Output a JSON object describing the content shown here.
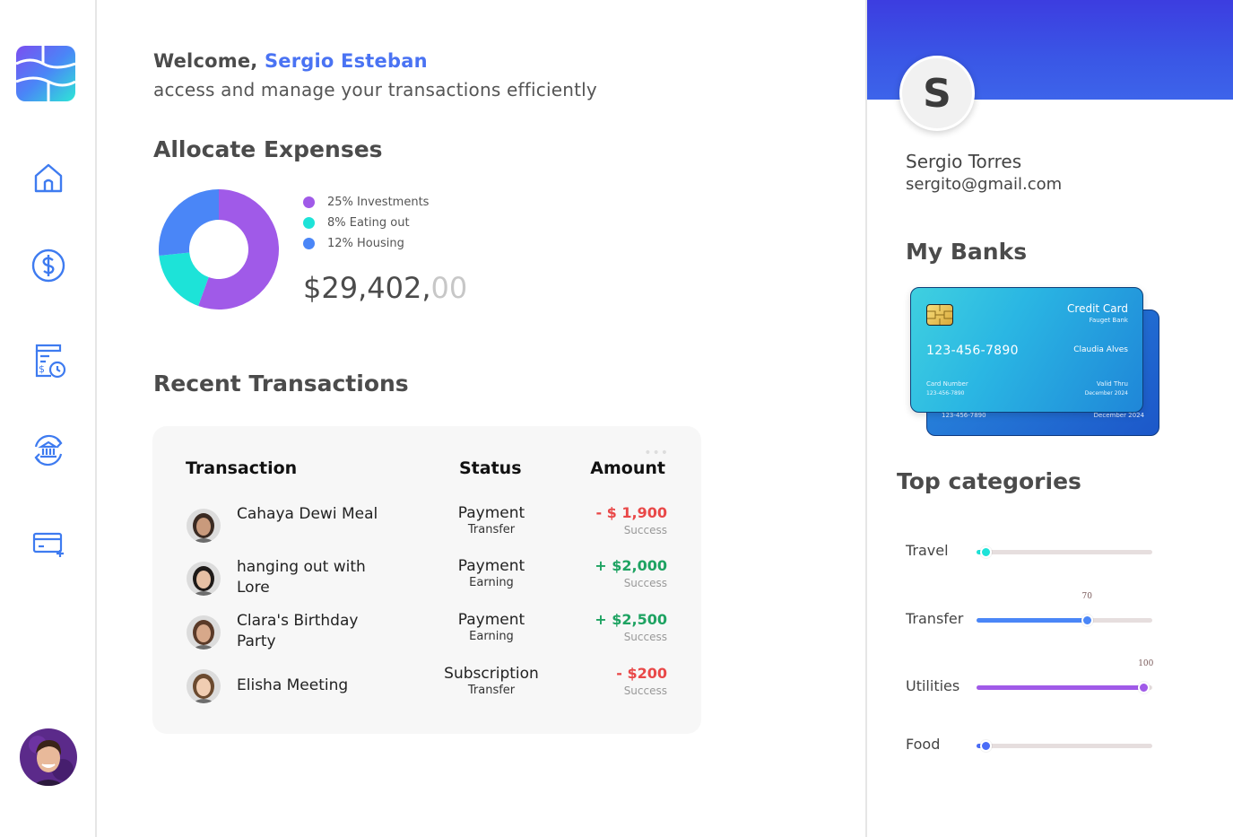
{
  "colors": {
    "accent": "#4a73f3",
    "investments": "#a05ae8",
    "eating_out": "#1de3d8",
    "housing": "#4a86f7",
    "negative": "#e94848",
    "positive": "#1ea362"
  },
  "sidebar": {
    "nav": [
      {
        "icon": "home-icon"
      },
      {
        "icon": "dollar-icon"
      },
      {
        "icon": "receipt-clock-icon"
      },
      {
        "icon": "bank-transfer-icon"
      },
      {
        "icon": "card-add-icon"
      }
    ]
  },
  "header": {
    "welcome_label": "Welcome, ",
    "user_name": "Sergio Esteban",
    "subtitle": "access and manage your transactions efficiently"
  },
  "expenses": {
    "title": "Allocate Expenses",
    "legend": [
      {
        "label": "25% Investments",
        "color": "#a05ae8"
      },
      {
        "label": "8% Eating out",
        "color": "#1de3d8"
      },
      {
        "label": "12% Housing",
        "color": "#4a86f7"
      }
    ],
    "total_main": "$29,402,",
    "total_cents": "00"
  },
  "chart_data": {
    "type": "pie",
    "labels": [
      "Investments",
      "Eating out",
      "Housing"
    ],
    "values": [
      25,
      8,
      12
    ]
  },
  "transactions": {
    "title": "Recent Transactions",
    "more": "•••",
    "columns": {
      "transaction": "Transaction",
      "status": "Status",
      "amount": "Amount"
    },
    "rows": [
      {
        "name": "Cahaya Dewi Meal",
        "status": "Payment",
        "substatus": "Transfer",
        "amount": "- $ 1,900",
        "state": "Success",
        "kind": "neg"
      },
      {
        "name": "hanging out with Lore",
        "status": "Payment",
        "substatus": "Earning",
        "amount": "+ $2,000",
        "state": "Success",
        "kind": "pos"
      },
      {
        "name": "Clara's Birthday Party",
        "status": "Payment",
        "substatus": "Earning",
        "amount": "+ $2,500",
        "state": "Success",
        "kind": "pos"
      },
      {
        "name": "Elisha Meeting",
        "status": "Subscription",
        "substatus": "Transfer",
        "amount": "- $200",
        "state": "Success",
        "kind": "neg"
      }
    ]
  },
  "profile": {
    "initial": "S",
    "name": "Sergio Torres",
    "email": "sergito@gmail.com"
  },
  "banks": {
    "title": "My Banks",
    "card": {
      "type": "Credit Card",
      "bank": "Fauget Bank",
      "number": "123-456-7890",
      "holder": "Claudia Alves",
      "number_label": "Card Number",
      "number_small": "123-456-7890",
      "valid_label": "Valid Thru",
      "valid_date": "December 2024"
    },
    "back_card": {
      "number_small": "123-456-7890",
      "valid_date": "December 2024"
    }
  },
  "categories": {
    "title": "Top categories",
    "items": [
      {
        "label": "Travel",
        "value": 5,
        "color": "#1de3d8",
        "value_label": ""
      },
      {
        "label": "Transfer",
        "value": 63,
        "color": "#4a86f7",
        "value_label": "70"
      },
      {
        "label": "Utilities",
        "value": 95,
        "color": "#a05ae8",
        "value_label": "100"
      },
      {
        "label": "Food",
        "value": 5,
        "color": "#4a6cf7",
        "value_label": ""
      }
    ]
  }
}
